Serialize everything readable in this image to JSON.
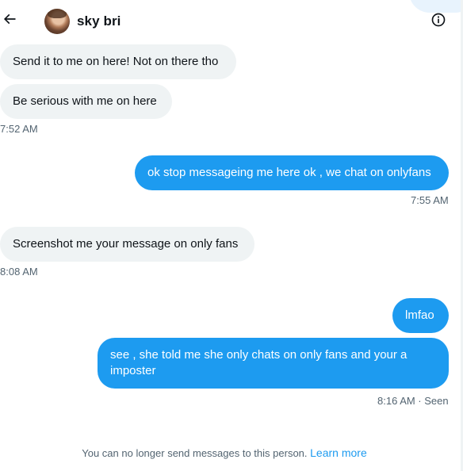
{
  "header": {
    "back_icon": "arrow-left-icon",
    "contact_name": "sky bri",
    "info_icon": "info-icon"
  },
  "messages": [
    {
      "direction": "in",
      "text": "Send it to me on here! Not on there tho"
    },
    {
      "direction": "in",
      "text": "Be serious with me on here"
    },
    {
      "timestamp": "7:52 AM"
    },
    {
      "direction": "out",
      "text": "ok stop messageing me here ok , we chat on onlyfans"
    },
    {
      "timestamp": "7:55 AM"
    },
    {
      "direction": "in",
      "text": "Screenshot me your message on only fans"
    },
    {
      "timestamp": "8:08 AM"
    },
    {
      "direction": "out",
      "text": "lmfao"
    },
    {
      "direction": "out",
      "text": "see , she told me she only chats on only fans and your a imposter"
    },
    {
      "timestamp": "8:16 AM · Seen"
    }
  ],
  "footer": {
    "notice": "You can no longer send messages to this person.",
    "link": "Learn more"
  },
  "colors": {
    "accent": "#1d9bf0",
    "incoming_bubble": "#eff3f4",
    "secondary_text": "#536471"
  }
}
